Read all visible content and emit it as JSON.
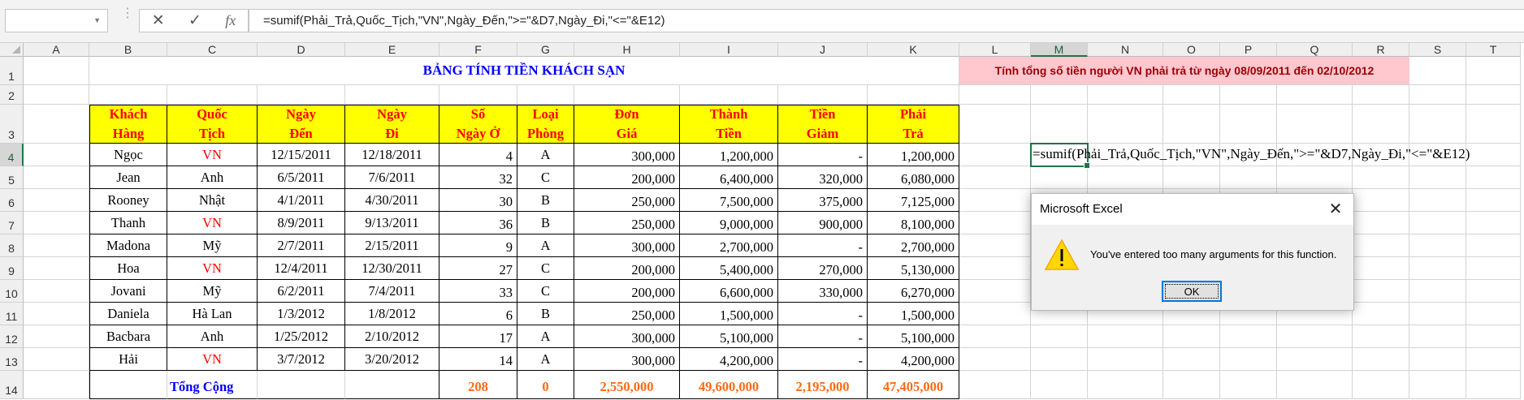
{
  "formula_bar": {
    "name_box": "",
    "cancel_icon": "✕",
    "enter_icon": "✓",
    "fx_label": "fx",
    "formula": "=sumif(Phải_Trả,Quốc_Tịch,\"VN\",Ngày_Đến,\">=\"&D7,Ngày_Đi,\"<=\"&E12)"
  },
  "columns": [
    "A",
    "B",
    "C",
    "D",
    "E",
    "F",
    "G",
    "H",
    "I",
    "J",
    "K",
    "L",
    "M",
    "N",
    "O",
    "P",
    "Q",
    "R",
    "S",
    "T"
  ],
  "rows": [
    "1",
    "2",
    "3",
    "4",
    "5",
    "6",
    "7",
    "8",
    "9",
    "10",
    "11",
    "12",
    "13",
    "14"
  ],
  "sheet": {
    "title": "BẢNG TÍNH TIỀN KHÁCH SẠN",
    "note": "Tính tổng số tiền người VN phải trả từ ngày 08/09/2011 đến 02/10/2012",
    "headers": [
      [
        "Khách",
        "Hàng"
      ],
      [
        "Quốc",
        "Tịch"
      ],
      [
        "Ngày",
        "Đến"
      ],
      [
        "Ngày",
        "Đi"
      ],
      [
        "Số",
        "Ngày Ở"
      ],
      [
        "Loại",
        "Phòng"
      ],
      [
        "Đơn",
        "Giá"
      ],
      [
        "Thành",
        "Tiền"
      ],
      [
        "Tiền",
        "Giảm"
      ],
      [
        "Phải",
        "Trả"
      ]
    ],
    "data": [
      [
        "Ngọc",
        "VN",
        "12/15/2011",
        "12/18/2011",
        "4",
        "A",
        "300,000",
        "1,200,000",
        "-",
        "1,200,000"
      ],
      [
        "Jean",
        "Anh",
        "6/5/2011",
        "7/6/2011",
        "32",
        "C",
        "200,000",
        "6,400,000",
        "320,000",
        "6,080,000"
      ],
      [
        "Rooney",
        "Nhật",
        "4/1/2011",
        "4/30/2011",
        "30",
        "B",
        "250,000",
        "7,500,000",
        "375,000",
        "7,125,000"
      ],
      [
        "Thanh",
        "VN",
        "8/9/2011",
        "9/13/2011",
        "36",
        "B",
        "250,000",
        "9,000,000",
        "900,000",
        "8,100,000"
      ],
      [
        "Madona",
        "Mỹ",
        "2/7/2011",
        "2/15/2011",
        "9",
        "A",
        "300,000",
        "2,700,000",
        "-",
        "2,700,000"
      ],
      [
        "Hoa",
        "VN",
        "12/4/2011",
        "12/30/2011",
        "27",
        "C",
        "200,000",
        "5,400,000",
        "270,000",
        "5,130,000"
      ],
      [
        "Jovani",
        "Mỹ",
        "6/2/2011",
        "7/4/2011",
        "33",
        "C",
        "200,000",
        "6,600,000",
        "330,000",
        "6,270,000"
      ],
      [
        "Daniela",
        "Hà Lan",
        "1/3/2012",
        "1/8/2012",
        "6",
        "B",
        "250,000",
        "1,500,000",
        "-",
        "1,500,000"
      ],
      [
        "Bacbara",
        "Anh",
        "1/25/2012",
        "2/10/2012",
        "17",
        "A",
        "300,000",
        "5,100,000",
        "-",
        "5,100,000"
      ],
      [
        "Hải",
        "VN",
        "3/7/2012",
        "3/20/2012",
        "14",
        "A",
        "300,000",
        "4,200,000",
        "-",
        "4,200,000"
      ]
    ],
    "total_label": "Tổng Cộng",
    "totals": [
      "208",
      "0",
      "2,550,000",
      "49,600,000",
      "2,195,000",
      "47,405,000"
    ]
  },
  "active_cell": {
    "ref": "M4",
    "text": "=sumif(Phải_Trả,Quốc_Tịch,\"VN\",Ngày_Đến,\">=\"&D7,Ngày_Đi,\"<=\"&E12)"
  },
  "dialog": {
    "title": "Microsoft Excel",
    "message": "You've entered too many arguments for this function.",
    "ok_label": "OK",
    "close_icon": "✕"
  },
  "colors": {
    "header_fill": "#ffff00",
    "header_text": "#ff0000",
    "title_text": "#0000ff",
    "total_text": "#ff6a13",
    "note_fill": "#ffc7ce",
    "note_text": "#9c0006",
    "excel_green": "#217346"
  }
}
